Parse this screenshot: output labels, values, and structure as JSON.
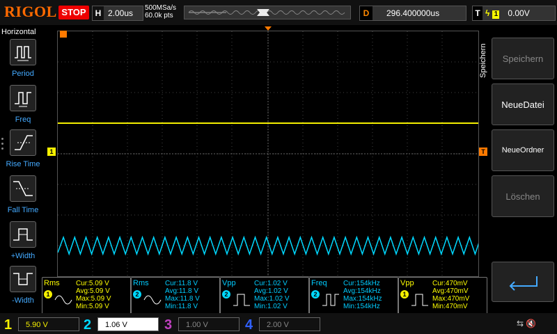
{
  "header": {
    "logo": "RIGOL",
    "run_state": "STOP",
    "timebase_key": "H",
    "timebase_value": "2.00us",
    "sample_rate": "500MSa/s",
    "points": "60.0k pts",
    "delay_key": "D",
    "delay_value": "296.400000us",
    "trigger_key": "T",
    "trigger_channel": "1",
    "trigger_level": "0.00V"
  },
  "left_panel": {
    "title": "Horizontal",
    "items": [
      {
        "label": "Period"
      },
      {
        "label": "Freq"
      },
      {
        "label": "Rise Time"
      },
      {
        "label": "Fall Time"
      },
      {
        "label": "+Width"
      },
      {
        "label": "-Width"
      }
    ]
  },
  "right_panel": {
    "title": "Speichern",
    "buttons": [
      "Speichern",
      "NeueDatei",
      "NeueOrdner",
      "Löschen"
    ]
  },
  "measurements": [
    {
      "name": "Rms",
      "channel": "1",
      "cur": "Cur:5.09 V",
      "avg": "Avg:5.09 V",
      "max": "Max:5.09 V",
      "min": "Min:5.09 V"
    },
    {
      "name": "Rms",
      "channel": "2",
      "cur": "Cur:11.8 V",
      "avg": "Avg:11.8 V",
      "max": "Max:11.8 V",
      "min": "Min:11.8 V"
    },
    {
      "name": "Vpp",
      "channel": "2",
      "cur": "Cur:1.02 V",
      "avg": "Avg:1.02 V",
      "max": "Max:1.02 V",
      "min": "Min:1.02 V"
    },
    {
      "name": "Freq",
      "channel": "2",
      "cur": "Cur:154kHz",
      "avg": "Avg:154kHz",
      "max": "Max:154kHz",
      "min": "Min:154kHz"
    },
    {
      "name": "Vpp",
      "channel": "1",
      "cur": "Cur:470mV",
      "avg": "Avg:470mV",
      "max": "Max:470mV",
      "min": "Min:470mV"
    }
  ],
  "channels": [
    {
      "num": "1",
      "value": "5.90 V"
    },
    {
      "num": "2",
      "value": "1.06 V"
    },
    {
      "num": "3",
      "value": "1.00 V"
    },
    {
      "num": "4",
      "value": "2.00 V"
    }
  ],
  "colors": {
    "ch1": "#f5f000",
    "ch2": "#00d8ff",
    "ch3": "#c040c0",
    "ch4": "#3060ff",
    "accent": "#ff7a00"
  },
  "screen_markers": {
    "ch1_marker": "1",
    "trigger_marker": "T"
  }
}
